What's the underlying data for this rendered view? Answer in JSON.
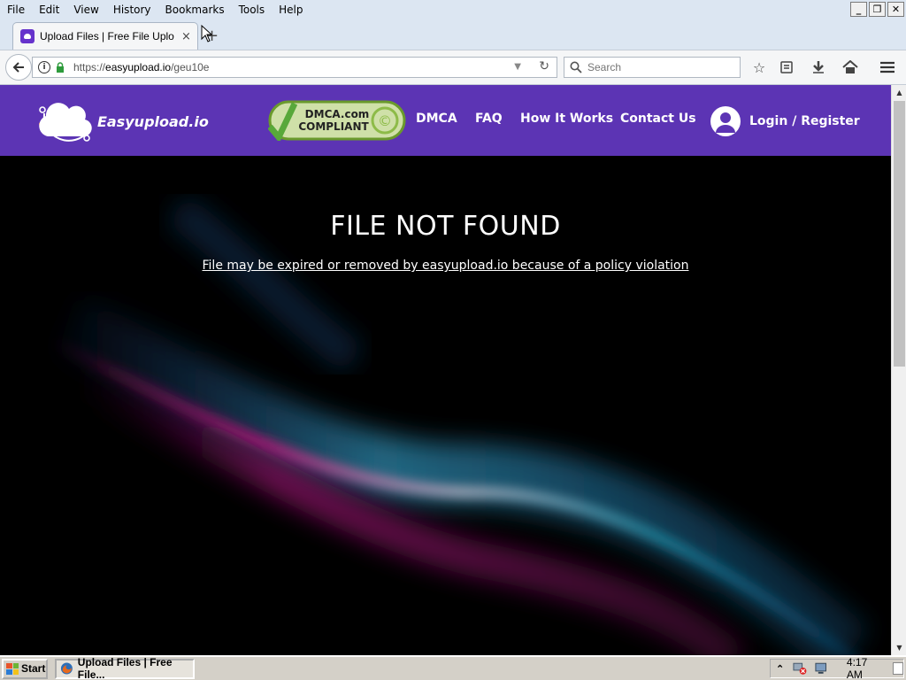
{
  "menubar": {
    "items": [
      "File",
      "Edit",
      "View",
      "History",
      "Bookmarks",
      "Tools",
      "Help"
    ]
  },
  "window_controls": {
    "minimize": "_",
    "restore": "❐",
    "close": "✕"
  },
  "tab": {
    "title": "Upload Files | Free File Upload",
    "close": "×",
    "new_tab": "+"
  },
  "urlbar": {
    "url_prefix": "https://",
    "url_domain": "easyupload.io",
    "url_path": "/geu10e"
  },
  "searchbar": {
    "placeholder": "Search"
  },
  "site": {
    "logo_text": "Easyupload.io",
    "dmca_line1": "DMCA.com",
    "dmca_line2": "COMPLIANT",
    "nav": {
      "dmca": "DMCA",
      "faq": "FAQ",
      "how_it_works": "How It Works",
      "contact": "Contact Us",
      "login": "Login / Register"
    },
    "brand_color": "#5c34b4"
  },
  "hero": {
    "title": "FILE NOT FOUND",
    "subtitle": "File may be expired or removed by easyupload.io because of a policy violation"
  },
  "taskbar": {
    "start_label": "Start",
    "task_label": "Upload Files | Free File...",
    "clock": "4:17 AM"
  }
}
